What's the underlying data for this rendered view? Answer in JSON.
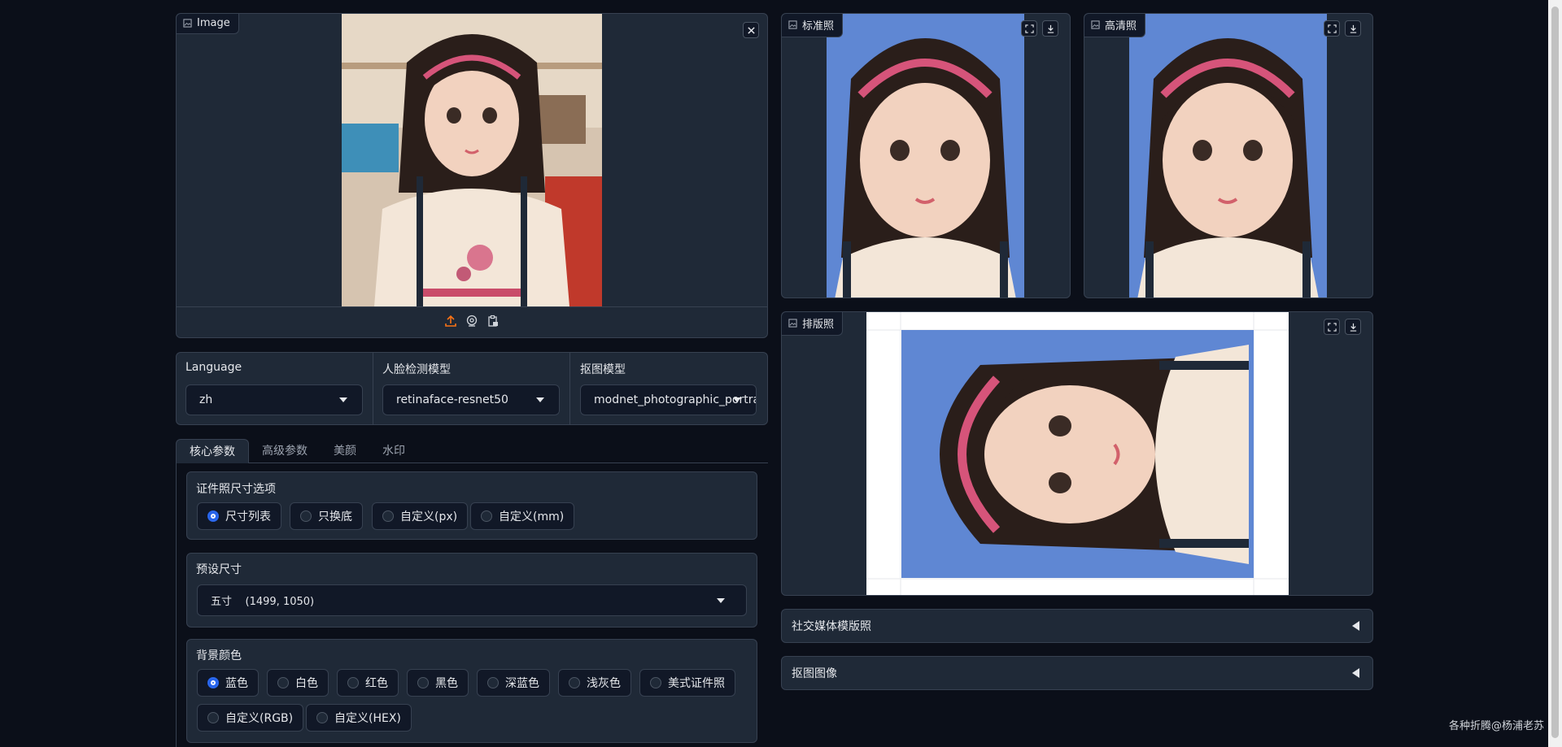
{
  "input_panel": {
    "label": "Image",
    "actions": [
      "upload-icon",
      "webcam-icon",
      "clipboard-icon"
    ]
  },
  "outputs": {
    "standard": {
      "label": "标准照"
    },
    "hd": {
      "label": "高清照"
    },
    "layout": {
      "label": "排版照"
    }
  },
  "selectors": {
    "language": {
      "label": "Language",
      "value": "zh"
    },
    "face_model": {
      "label": "人脸检测模型",
      "value": "retinaface-resnet50"
    },
    "matting_model": {
      "label": "抠图模型",
      "value": "modnet_photographic_portrait"
    }
  },
  "tabs": [
    "核心参数",
    "高级参数",
    "美颜",
    "水印"
  ],
  "size_options": {
    "label": "证件照尺寸选项",
    "options": [
      "尺寸列表",
      "只换底",
      "自定义(px)",
      "自定义(mm)"
    ],
    "selected": "尺寸列表"
  },
  "preset_size": {
    "label": "预设尺寸",
    "value": "五寸    (1499, 1050)"
  },
  "bg_color": {
    "label": "背景颜色",
    "options": [
      "蓝色",
      "白色",
      "红色",
      "黑色",
      "深蓝色",
      "浅灰色",
      "美式证件照",
      "自定义(RGB)",
      "自定义(HEX)"
    ],
    "selected": "蓝色"
  },
  "accordions": [
    "社交媒体模版照",
    "抠图图像"
  ],
  "watermark": "各种折腾@杨浦老苏",
  "colors": {
    "accent": "#2563eb",
    "photo_bg": "#5f87d3",
    "upload": "#f97316"
  }
}
